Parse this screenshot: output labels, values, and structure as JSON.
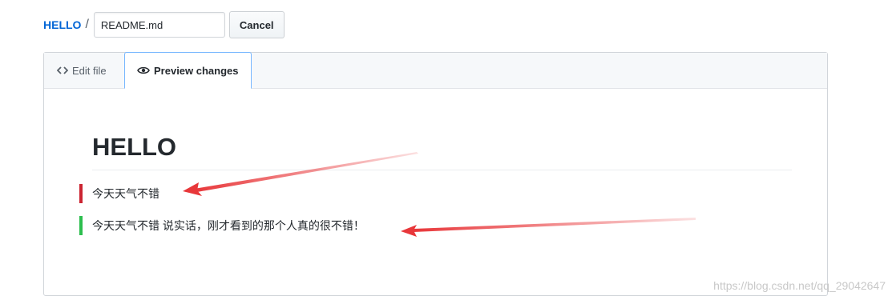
{
  "breadcrumb": {
    "repo": "HELLO",
    "separator": "/",
    "filename_value": "README.md"
  },
  "cancel_label": "Cancel",
  "tabs": [
    {
      "label": "Edit file",
      "icon": "code-icon",
      "active": false
    },
    {
      "label": "Preview changes",
      "icon": "eye-icon",
      "active": true
    }
  ],
  "preview": {
    "heading": "HELLO",
    "lines": [
      {
        "text": "今天天气不错",
        "change": "removed"
      },
      {
        "text": "今天天气不错 说实话，刚才看到的那个人真的很不错！",
        "change": "added"
      }
    ]
  },
  "colors": {
    "link": "#0366d6",
    "removed_marker": "#cb2431",
    "added_marker": "#2cbe4e",
    "arrow": "#e8373a"
  },
  "watermark": "https://blog.csdn.net/qq_29042647"
}
